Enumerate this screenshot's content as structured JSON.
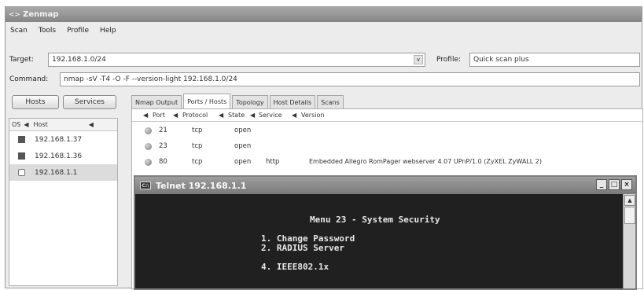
{
  "window": {
    "title": "Zenmap"
  },
  "menu": [
    "Scan",
    "Tools",
    "Profile",
    "Help"
  ],
  "target": {
    "label": "Target:",
    "value": "192.168.1.0/24"
  },
  "profile": {
    "label": "Profile:",
    "value": "Quick scan plus"
  },
  "command": {
    "label": "Command:",
    "value": "nmap -sV -T4 -O -F --version-light 192.168.1.0/24"
  },
  "buttons": {
    "hosts": "Hosts",
    "services": "Services"
  },
  "hostlist": {
    "os_header": "OS",
    "host_header": "Host",
    "rows": [
      {
        "os_icon": "windows-icon",
        "host": "192.168.1.37"
      },
      {
        "os_icon": "windows-icon",
        "host": "192.168.1.36"
      },
      {
        "os_icon": "generic-device-icon",
        "host": "192.168.1.1"
      }
    ]
  },
  "tabs": [
    "Nmap Output",
    "Ports / Hosts",
    "Topology",
    "Host Details",
    "Scans"
  ],
  "ports": {
    "headers": {
      "port": "Port",
      "protocol": "Protocol",
      "state": "State",
      "service": "Service",
      "version": "Version"
    },
    "rows": [
      {
        "port": "21",
        "protocol": "tcp",
        "state": "open",
        "service": "",
        "version": ""
      },
      {
        "port": "23",
        "protocol": "tcp",
        "state": "open",
        "service": "",
        "version": ""
      },
      {
        "port": "80",
        "protocol": "tcp",
        "state": "open",
        "service": "http",
        "version": "Embedded Allegro RomPager webserver 4.07 UPnP/1.0 (ZyXEL ZyWALL 2)"
      }
    ]
  },
  "telnet": {
    "title": "Telnet 192.168.1.1",
    "menu_title": "Menu 23 - System Security",
    "item1": "1. Change Password",
    "item2": "2. RADIUS Server",
    "item4": "4. IEEE802.1x"
  }
}
